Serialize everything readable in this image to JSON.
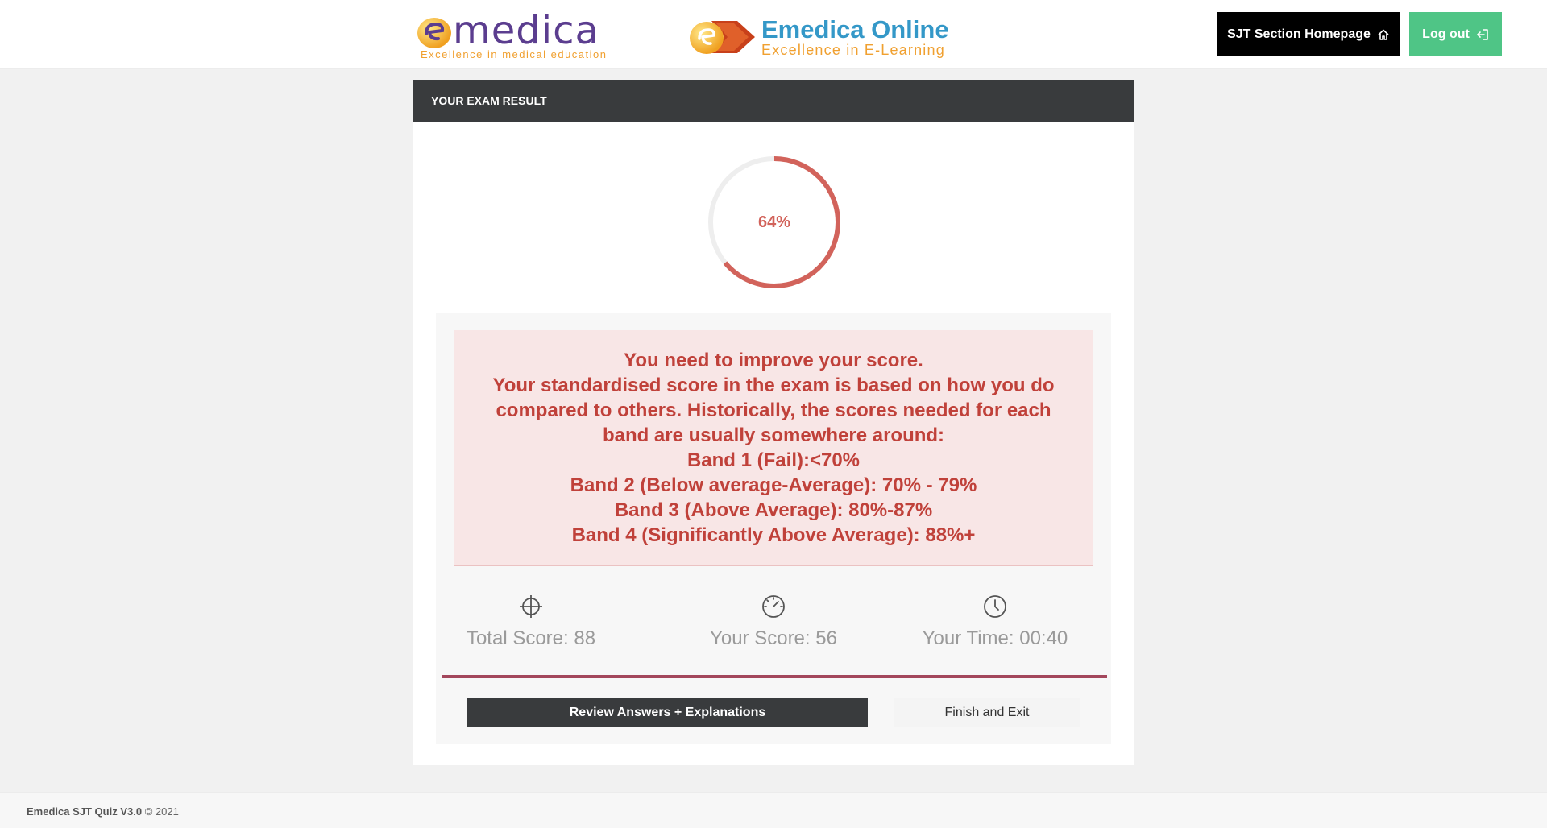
{
  "header": {
    "logo1": {
      "word": "medica",
      "tagline": "Excellence in medical education"
    },
    "logo2": {
      "word": "Emedica Online",
      "tagline": "Excellence in E-Learning"
    },
    "home_button": "SJT Section Homepage",
    "logout_button": "Log out"
  },
  "panel": {
    "title": "YOUR EXAM RESULT",
    "score_percent": 64,
    "score_label": "64%"
  },
  "alert": {
    "lines": [
      "You need to improve your score.",
      "Your standardised score in the exam is based on how you do compared to others. Historically, the scores needed for each band are usually somewhere around:",
      "Band 1 (Fail):<70%",
      "Band 2 (Below average-Average): 70% - 79%",
      "Band 3 (Above Average): 80%-87%",
      "Band 4 (Significantly Above Average): 88%+"
    ]
  },
  "stats": {
    "total": "Total Score: 88",
    "yours": "Your Score: 56",
    "time": "Your Time: 00:40"
  },
  "actions": {
    "review": "Review Answers + Explanations",
    "finish": "Finish and Exit"
  },
  "footer": {
    "name": "Emedica SJT Quiz V3.0",
    "copyright": "© 2021"
  },
  "colors": {
    "accent_red": "#d2635b",
    "gauge_track": "#eeeeee",
    "alert_text": "#c0413a",
    "logout_green": "#4fc586",
    "rule": "#a3475c"
  }
}
